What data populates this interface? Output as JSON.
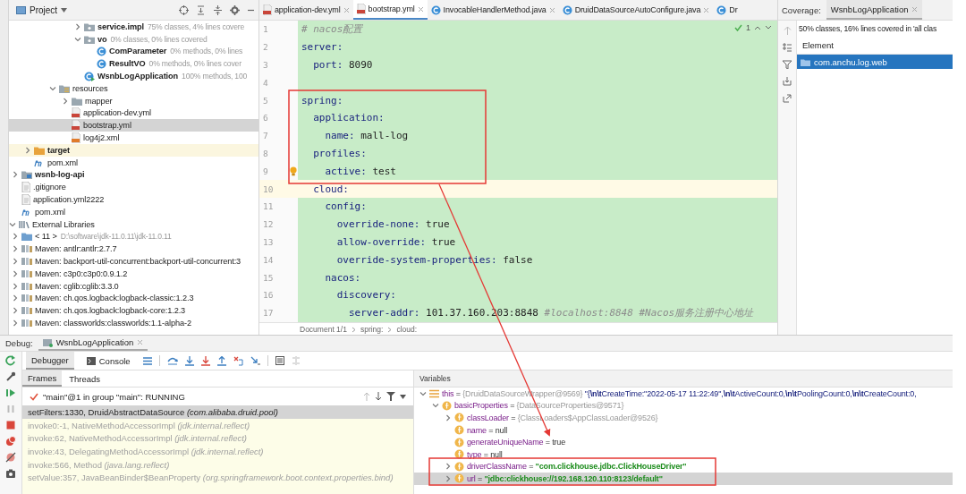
{
  "project": {
    "title": "Project",
    "tree": [
      {
        "children": [
          {
            "children": [
              {
                "children": [
                  {
                    "children": [
                      {
                        "children": [
                          {
                            "children": [
                              {
                                "label": "service.impl",
                                "note": "75% classes, 4% lines covere",
                                "kind": "package",
                                "expanded": false,
                                "selected": false
                              },
                              {
                                "label": "vo",
                                "note": "0% classes, 0% lines covered",
                                "kind": "package",
                                "expanded": true,
                                "selected": false,
                                "children": [
                                  {
                                    "label": "ComParameter",
                                    "note": "0% methods, 0% lines",
                                    "kind": "class",
                                    "selected": false
                                  },
                                  {
                                    "label": "ResultVO",
                                    "note": "0% methods, 0% lines cover",
                                    "kind": "class",
                                    "selected": false
                                  }
                                ]
                              },
                              {
                                "label": "WsnbLogApplication",
                                "note": "100% methods, 100",
                                "kind": "app-class",
                                "selected": false
                              }
                            ]
                          }
                        ]
                      },
                      {
                        "label": "resources",
                        "kind": "resources",
                        "expanded": true,
                        "selected": false,
                        "children": [
                          {
                            "label": "mapper",
                            "kind": "folder",
                            "expanded": false,
                            "selected": false
                          },
                          {
                            "label": "application-dev.yml",
                            "kind": "yml",
                            "selected": false
                          },
                          {
                            "label": "bootstrap.yml",
                            "kind": "yml",
                            "selected": true
                          },
                          {
                            "label": "log4j2.xml",
                            "kind": "xml",
                            "selected": false
                          }
                        ]
                      }
                    ]
                  }
                ]
              },
              {
                "label": "target",
                "kind": "excluded",
                "expanded": false,
                "selected": false
              },
              {
                "label": "pom.xml",
                "kind": "pom",
                "selected": false
              }
            ]
          },
          {
            "label": "wsnb-log-api",
            "kind": "module",
            "expanded": false,
            "selected": false
          },
          {
            "label": ".gitignore",
            "kind": "file",
            "selected": false
          },
          {
            "label": "application.yml2222",
            "kind": "file",
            "selected": false
          },
          {
            "label": "pom.xml",
            "kind": "pom",
            "selected": false
          }
        ]
      },
      {
        "label": "External Libraries",
        "kind": "libraries",
        "expanded": true,
        "selected": false,
        "children": [
          {
            "label": "< 11 >",
            "note": "D:\\software\\jdk-11.0.11\\jdk-11.0.11",
            "kind": "sdk",
            "expanded": false,
            "selected": false
          },
          {
            "label": "Maven: antlr:antlr:2.7.7",
            "kind": "library",
            "expanded": false,
            "selected": false
          },
          {
            "label": "Maven: backport-util-concurrent:backport-util-concurrent:3",
            "kind": "library",
            "expanded": false,
            "selected": false
          },
          {
            "label": "Maven: c3p0:c3p0:0.9.1.2",
            "kind": "library",
            "expanded": false,
            "selected": false
          },
          {
            "label": "Maven: cglib:cglib:3.3.0",
            "kind": "library",
            "expanded": false,
            "selected": false
          },
          {
            "label": "Maven: ch.qos.logback:logback-classic:1.2.3",
            "kind": "library",
            "expanded": false,
            "selected": false
          },
          {
            "label": "Maven: ch.qos.logback:logback-core:1.2.3",
            "kind": "library",
            "expanded": false,
            "selected": false
          },
          {
            "label": "Maven: classworlds:classworlds:1.1-alpha-2",
            "kind": "library",
            "expanded": false,
            "selected": false
          }
        ]
      }
    ]
  },
  "editor": {
    "tabs": [
      {
        "label": "application-dev.yml",
        "kind": "yml",
        "selected": false,
        "closable": true
      },
      {
        "label": "bootstrap.yml",
        "kind": "yml",
        "selected": true,
        "closable": true
      },
      {
        "label": "InvocableHandlerMethod.java",
        "kind": "java",
        "selected": false,
        "closable": true
      },
      {
        "label": "DruidDataSourceAutoConfigure.java",
        "kind": "java",
        "selected": false,
        "closable": true
      },
      {
        "label": "Dr",
        "kind": "java",
        "selected": false,
        "closable": false
      }
    ],
    "inspection_count": "1",
    "lines": [
      {
        "number": "1",
        "comment": "# nacos配置",
        "current": false,
        "hint": false
      },
      {
        "number": "2",
        "key": "server:",
        "current": false,
        "hint": false
      },
      {
        "number": "3",
        "key": "  port:",
        "value": "8090",
        "current": false,
        "hint": false
      },
      {
        "number": "4",
        "current": false,
        "hint": false
      },
      {
        "number": "5",
        "key": "spring:",
        "current": false,
        "hint": false
      },
      {
        "number": "6",
        "key": "  application:",
        "current": false,
        "hint": false
      },
      {
        "number": "7",
        "key": "    name:",
        "value": "mall-log",
        "current": false,
        "hint": false
      },
      {
        "number": "8",
        "key": "  profiles:",
        "current": false,
        "hint": false
      },
      {
        "number": "9",
        "key": "    active:",
        "value": "test",
        "current": false,
        "hint": true
      },
      {
        "number": "10",
        "key": "  cloud:",
        "current": true,
        "hint": false
      },
      {
        "number": "11",
        "key": "    config:",
        "current": false,
        "hint": false
      },
      {
        "number": "12",
        "key": "      override-none:",
        "value": "true",
        "current": false,
        "hint": false
      },
      {
        "number": "13",
        "key": "      allow-override:",
        "value": "true",
        "current": false,
        "hint": false
      },
      {
        "number": "14",
        "key": "      override-system-properties:",
        "value": "false",
        "current": false,
        "hint": false
      },
      {
        "number": "15",
        "key": "    nacos:",
        "current": false,
        "hint": false
      },
      {
        "number": "16",
        "key": "      discovery:",
        "current": false,
        "hint": false
      },
      {
        "number": "17",
        "key": "        server-addr:",
        "value": "101.37.160.203:8848",
        "comment": "#localhost:8848 #Nacos服务注册中心地址",
        "current": false,
        "hint": false
      }
    ],
    "breadcrumbs": [
      "Document 1/1",
      "spring:",
      "cloud:"
    ]
  },
  "coverage": {
    "title": "Coverage:",
    "tab": "WsnbLogApplication",
    "summary": "50% classes, 16% lines covered in 'all clas",
    "column": "Element",
    "rows": [
      {
        "label": "com.anchu.log.web",
        "selected": true
      }
    ]
  },
  "debug": {
    "title": "Debug:",
    "session": "WsnbLogApplication",
    "tabs": [
      {
        "label": "Debugger",
        "selected": true
      },
      {
        "label": "Console",
        "selected": false
      }
    ],
    "subtabs": [
      {
        "label": "Frames",
        "selected": true
      },
      {
        "label": "Threads",
        "selected": false
      }
    ],
    "thread": "\"main\"@1 in group \"main\": RUNNING",
    "frames": [
      {
        "method": "setFilters:1330, DruidAbstractDataSource",
        "package": "(com.alibaba.druid.pool)",
        "kind": "user",
        "selected": true
      },
      {
        "method": "invoke0:-1, NativeMethodAccessorImpl",
        "package": "(jdk.internal.reflect)",
        "kind": "library",
        "selected": false
      },
      {
        "method": "invoke:62, NativeMethodAccessorImpl",
        "package": "(jdk.internal.reflect)",
        "kind": "library",
        "selected": false
      },
      {
        "method": "invoke:43, DelegatingMethodAccessorImpl",
        "package": "(jdk.internal.reflect)",
        "kind": "library",
        "selected": false
      },
      {
        "method": "invoke:566, Method",
        "package": "(java.lang.reflect)",
        "kind": "library",
        "selected": false
      },
      {
        "method": "setValue:357, JavaBeanBinder$BeanProperty",
        "package": "(org.springframework.boot.context.properties.bind)",
        "kind": "library",
        "selected": false
      }
    ],
    "variables_title": "Variables",
    "variables": [
      {
        "name": "this",
        "sep": "=",
        "type": "{DruidDataSourceWrapper@9569}",
        "value": "\"{**\\n\\t**CreateTime:\"2022-05-17 11:22:49\",**\\n\\t**ActiveCount:0,**\\n\\t**PoolingCount:0,**\\n\\t**CreateCount:0,",
        "kind": "object",
        "expanded": true,
        "selected": false,
        "children": [
          {
            "name": "basicProperties",
            "sep": "=",
            "type": "{DataSourceProperties@9571}",
            "kind": "field",
            "expanded": true,
            "selected": false,
            "children": [
              {
                "name": "classLoader",
                "sep": "=",
                "type": "{ClassLoaders$AppClassLoader@9526}",
                "kind": "field",
                "expanded": false,
                "selected": false
              },
              {
                "name": "name",
                "sep": "=",
                "value": "null",
                "kind": "field",
                "selected": false
              },
              {
                "name": "generateUniqueName",
                "sep": "=",
                "value": "true",
                "kind": "field",
                "selected": false
              },
              {
                "name": "type",
                "sep": "=",
                "value": "null",
                "kind": "field",
                "selected": false
              },
              {
                "name": "driverClassName",
                "sep": "=",
                "value": "\"com.clickhouse.jdbc.ClickHouseDriver\"",
                "kind": "string",
                "expanded": false,
                "selected": false
              },
              {
                "name": "url",
                "sep": "=",
                "value": "\"jdbc:clickhouse://192.168.120.110:8123/default\"",
                "kind": "string",
                "expanded": false,
                "selected": true
              }
            ]
          }
        ]
      }
    ]
  }
}
